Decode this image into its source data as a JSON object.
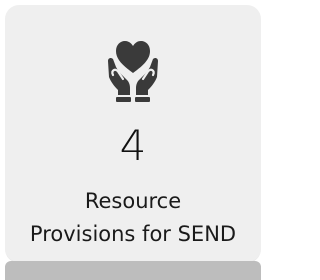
{
  "tile": {
    "icon": "heart-in-hands-icon",
    "count": "4",
    "label_line1": "Resource",
    "label_line2": "Provisions for SEND"
  },
  "colors": {
    "card_background": "#efefef",
    "icon_color": "#3a3a3a",
    "shadow_bar": "#bdbdbd",
    "text": "#111111"
  }
}
